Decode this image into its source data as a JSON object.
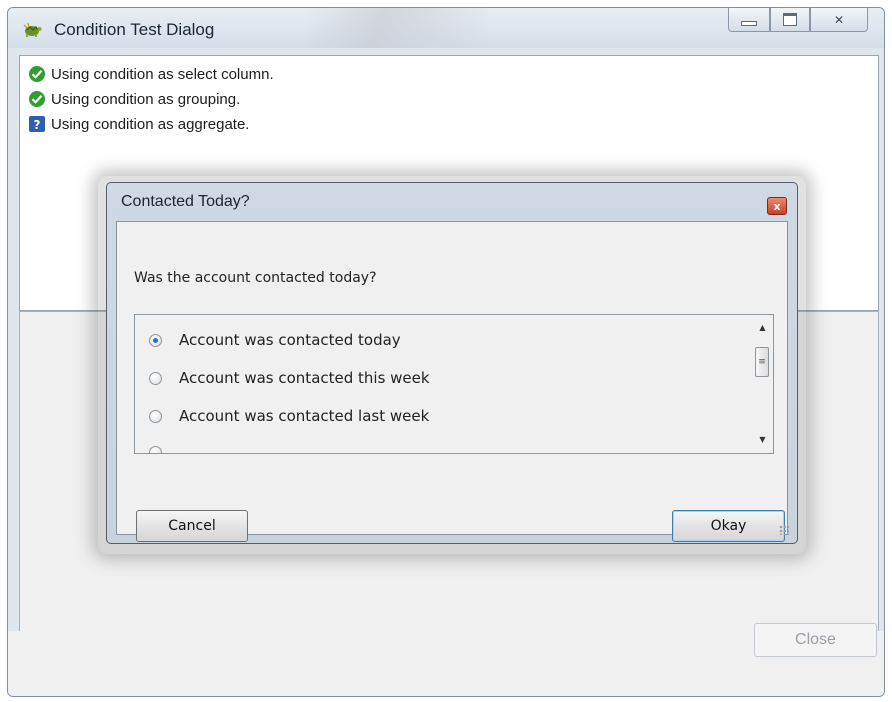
{
  "window": {
    "title": "Condition Test Dialog",
    "icon": "turtle-app-icon",
    "controls": {
      "minimize": "minimize-icon",
      "maximize": "maximize-icon",
      "close": "✕"
    }
  },
  "log": {
    "lines": [
      {
        "icon": "success-check-icon",
        "text": "Using condition as select column."
      },
      {
        "icon": "success-check-icon",
        "text": "Using condition as grouping."
      },
      {
        "icon": "question-icon",
        "text": "Using condition as aggregate."
      }
    ]
  },
  "footer": {
    "close_label": "Close"
  },
  "modal": {
    "title": "Contacted Today?",
    "close_glyph": "x",
    "question": "Was the account contacted today?",
    "options": [
      {
        "label": "Account was contacted today",
        "selected": true
      },
      {
        "label": "Account was contacted this week",
        "selected": false
      },
      {
        "label": "Account was contacted last week",
        "selected": false
      }
    ],
    "scroll": {
      "up": "▲",
      "down": "▼",
      "thumb_grip": "≡"
    },
    "cancel_label": "Cancel",
    "okay_label": "Okay"
  },
  "colors": {
    "success": "#2e9e2e",
    "question": "#2f5fb0",
    "default_button_border": "#3c7fb1",
    "radio_selected": "#2b6fd0"
  }
}
